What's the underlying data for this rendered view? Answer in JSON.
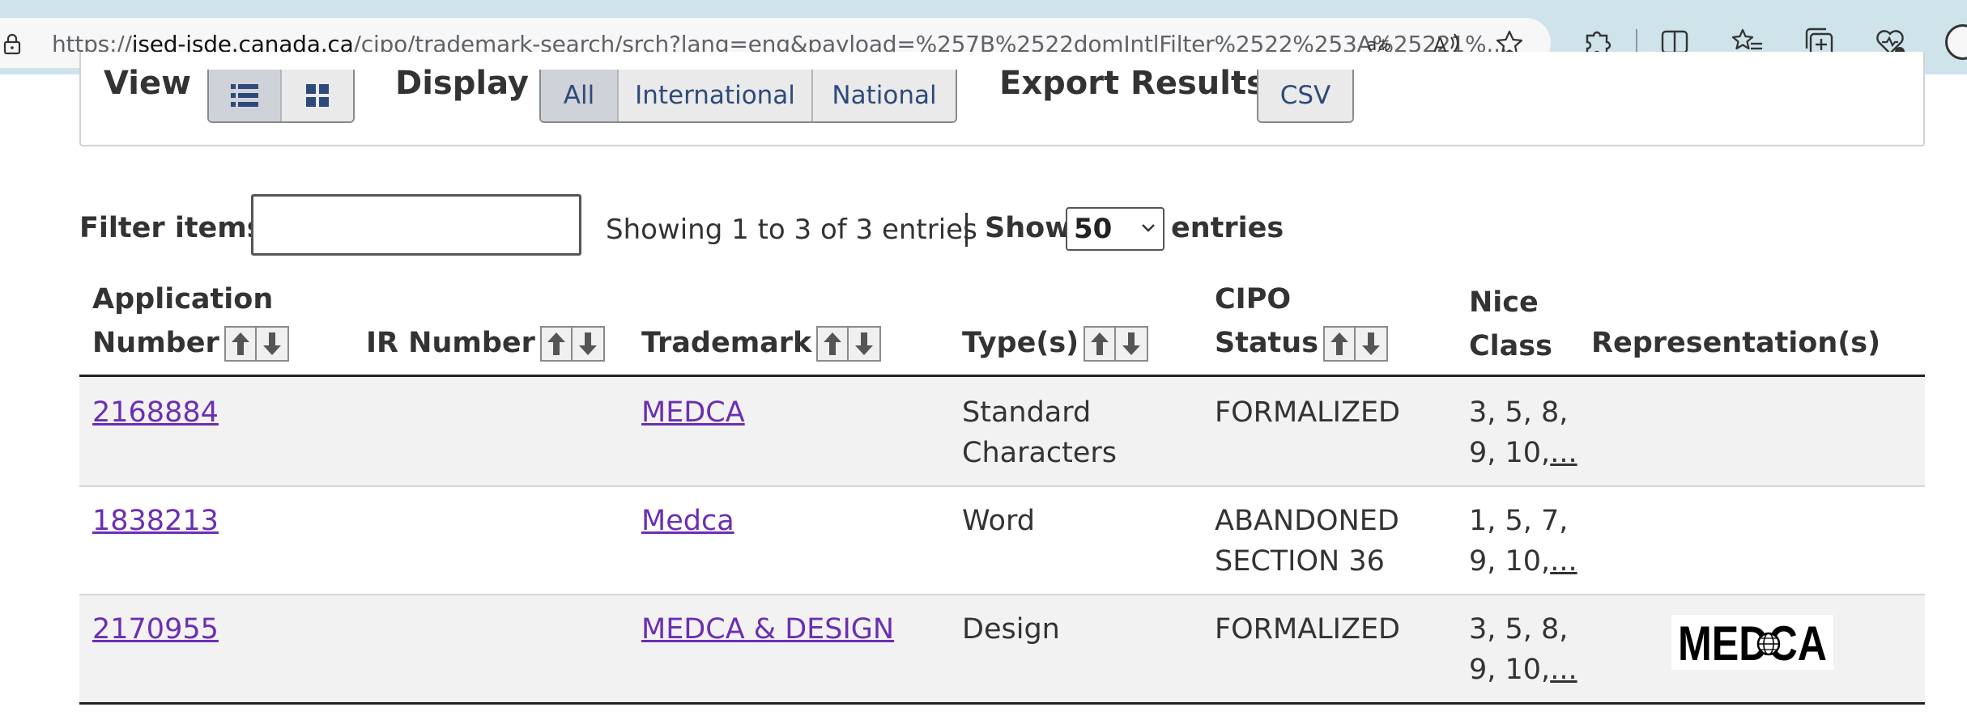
{
  "browser": {
    "url_host": "ised-isde.canada.ca",
    "url_prefix": "https://",
    "url_path": "/cipo/trademark-search/srch?lang=eng&payload=%257B%2522domIntlFilter%2522%253A%25221%..."
  },
  "toolbar": {
    "view_label": "View",
    "display_label": "Display",
    "display_options": [
      "All",
      "International",
      "National"
    ],
    "display_selected": "All",
    "export_label": "Export Results",
    "export_csv": "CSV"
  },
  "filter": {
    "label": "Filter items",
    "value": "",
    "showing_text": "Showing 1 to 3 of 3 entries",
    "show_label": "Show",
    "show_value": "50",
    "entries_label": "entries"
  },
  "table": {
    "headers": {
      "application_number_1": "Application",
      "application_number_2": "Number",
      "ir_number": "IR Number",
      "trademark": "Trademark",
      "types": "Type(s)",
      "cipo_status_1": "CIPO",
      "cipo_status_2": "Status",
      "nice_class_1": "Nice",
      "nice_class_2": "Class",
      "representations": "Representation(s)"
    },
    "rows": [
      {
        "application_number": "2168884",
        "ir_number": "",
        "trademark": "MEDCA",
        "type_1": "Standard",
        "type_2": "Characters",
        "status_1": "FORMALIZED",
        "status_2": "",
        "nice_1": "3, 5, 8,",
        "nice_2": "9, 10,",
        "nice_more": "...",
        "representation": ""
      },
      {
        "application_number": "1838213",
        "ir_number": "",
        "trademark": "Medca",
        "type_1": "Word",
        "type_2": "",
        "status_1": "ABANDONED",
        "status_2": "SECTION 36",
        "nice_1": "1, 5, 7,",
        "nice_2": "9, 10,",
        "nice_more": "...",
        "representation": ""
      },
      {
        "application_number": "2170955",
        "ir_number": "",
        "trademark": "MEDCA & DESIGN",
        "type_1": "Design",
        "type_2": "",
        "status_1": "FORMALIZED",
        "status_2": "",
        "nice_1": "3, 5, 8,",
        "nice_2": "9, 10,",
        "nice_more": "...",
        "representation": "MEDCA"
      }
    ]
  },
  "colors": {
    "link": "#6b2fb3",
    "chrome_bg": "#cfe3ea",
    "row_alt": "#f2f2f2"
  },
  "icons": [
    "lock-icon",
    "read-aloud-translate-icon",
    "read-aloud-icon",
    "favorite-star-icon",
    "extensions-icon",
    "split-screen-icon",
    "favorites-icon",
    "collections-icon",
    "browser-essentials-icon",
    "list-view-icon",
    "grid-view-icon",
    "sort-ascending-icon",
    "sort-descending-icon"
  ]
}
